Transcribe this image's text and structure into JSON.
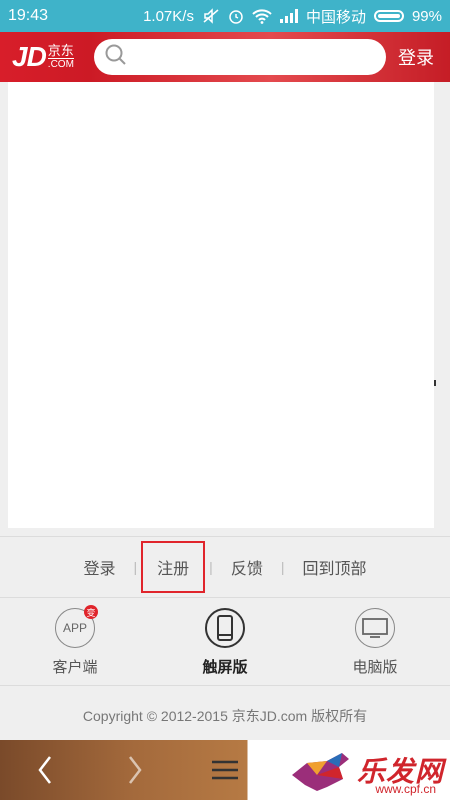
{
  "status": {
    "time": "19:43",
    "speed": "1.07K/s",
    "carrier": "中国移动",
    "battery": "99%"
  },
  "header": {
    "logo_main": "JD",
    "logo_cn": "京东",
    "logo_com": ".COM",
    "search_placeholder": "",
    "login": "登录"
  },
  "footer_links": {
    "login": "登录",
    "register": "注册",
    "feedback": "反馈",
    "back_to_top": "回到顶部"
  },
  "versions": {
    "app_icon_text": "APP",
    "app_badge": "变",
    "client": "客户端",
    "touch": "触屏版",
    "pc": "电脑版"
  },
  "copyright": "Copyright © 2012-2015 京东JD.com 版权所有",
  "watermark": {
    "text": "乐发网",
    "url": "www.cpf.cn"
  }
}
